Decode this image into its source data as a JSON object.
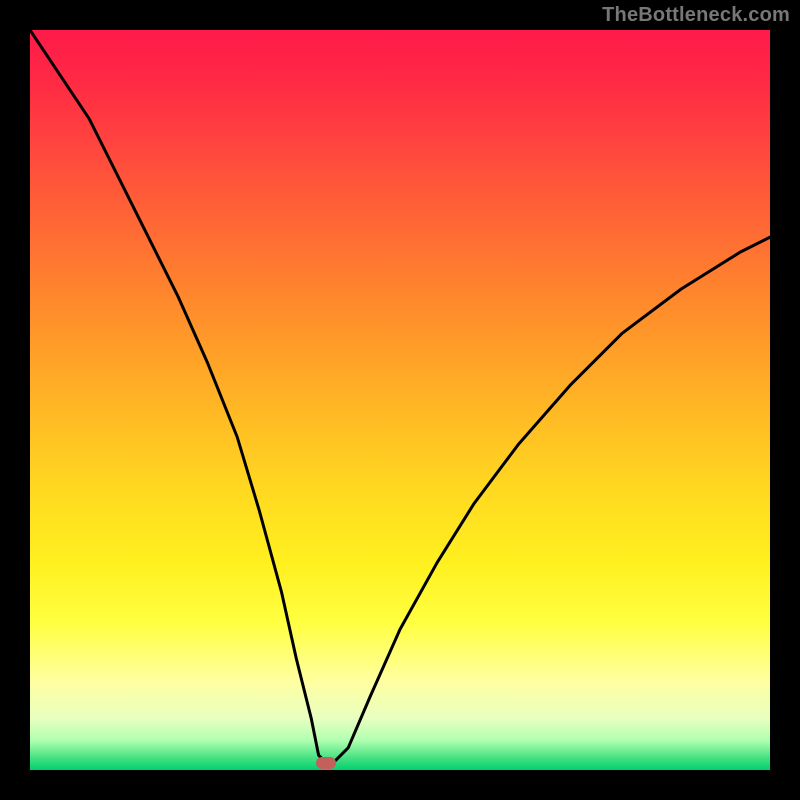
{
  "watermark": "TheBottleneck.com",
  "chart_data": {
    "type": "line",
    "title": "",
    "subtitle": "",
    "xlabel": "",
    "ylabel": "",
    "xlim": [
      0,
      100
    ],
    "ylim": [
      0,
      100
    ],
    "grid": false,
    "legend": false,
    "marker": {
      "x": 40,
      "y": 1,
      "color": "#c4605c"
    },
    "gradient_stops": [
      {
        "pos": 0,
        "color": "#ff1a4a"
      },
      {
        "pos": 50,
        "color": "#ffba24"
      },
      {
        "pos": 80,
        "color": "#ffff40"
      },
      {
        "pos": 100,
        "color": "#00d070"
      }
    ],
    "series": [
      {
        "name": "bottleneck-curve",
        "color": "#000000",
        "x": [
          0,
          4,
          8,
          12,
          16,
          20,
          24,
          28,
          31,
          34,
          36,
          38,
          39,
          40,
          41,
          43,
          46,
          50,
          55,
          60,
          66,
          73,
          80,
          88,
          96,
          100
        ],
        "y": [
          100,
          94,
          88,
          80,
          72,
          64,
          55,
          45,
          35,
          24,
          15,
          7,
          2,
          1,
          1,
          3,
          10,
          19,
          28,
          36,
          44,
          52,
          59,
          65,
          70,
          72
        ]
      }
    ]
  }
}
